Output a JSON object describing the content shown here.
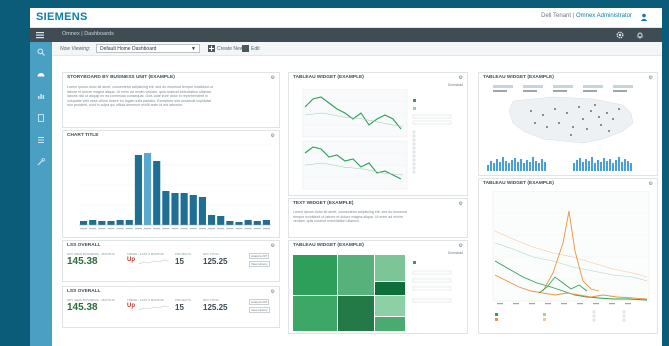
{
  "app": {
    "brand": "SIEMENS",
    "user_name": "Dell Tenant",
    "separator": "|",
    "user_role": "Omnex Administrator"
  },
  "breadcrumb": "Omnex | Dashboards",
  "viewbar": {
    "label": "Now Viewing:",
    "selected": "Default Home Dashboard",
    "create_new": "Create New",
    "edit": "Edit"
  },
  "storyboard": {
    "title": "STORYBOARD BY BUSINESS UNIT (EXAMPLE)",
    "lines": [
      "Lorem ipsum dolor sit amet, consectetur adipiscing elit, sed do eiusmod tempor incididunt ut",
      "labore et dolore magna aliqua. Ut enim ad minim veniam, quis nostrud exercitation ullamco",
      "laboris nisi ut aliquip ex ea commodo consequat. Duis aute irure dolor in reprehenderit in",
      "voluptate velit esse cillum dolore eu fugiat nulla pariatur. Excepteur sint occaecat cupidatat",
      "non proident, sunt in culpa qui officia deserunt mollit anim id est laborum."
    ]
  },
  "chart_title": {
    "title": "CHART TITLE"
  },
  "chart_data": {
    "type": "bar",
    "title": "CHART TITLE",
    "categories": [
      "1",
      "2",
      "3",
      "4",
      "5",
      "6",
      "7",
      "8",
      "9",
      "10",
      "11",
      "12",
      "13",
      "14",
      "15",
      "16",
      "17",
      "18",
      "19",
      "20",
      "21"
    ],
    "values": [
      4,
      5,
      4,
      4,
      5,
      5,
      70,
      72,
      64,
      34,
      32,
      32,
      30,
      28,
      10,
      9,
      4,
      3,
      5,
      4,
      5
    ],
    "highlight_index": 7,
    "ylim": [
      0,
      80
    ],
    "colors": {
      "bar": "#1f6e94",
      "highlight": "#5aa9cf"
    }
  },
  "lss1": {
    "title": "LSS OVERALL",
    "label1": "NPV (NEW BUSINESS) - MONTHS",
    "value1": "145.38",
    "label2": "TREND - LAST 6 MONTHS",
    "trend": "Up",
    "label3": "PROJECTS",
    "value3": "15",
    "label4": "NPV TOTAL",
    "value4": "125.25",
    "btn1": "Analyze KPI",
    "btn2": "View History"
  },
  "lss2": {
    "title": "LSS OVERALL",
    "label1": "NPV (NEW BUSINESS) - MONTHS",
    "value1": "145.38",
    "label2": "TREND - LAST 6 MONTHS",
    "trend": "Up",
    "label3": "PROJECTS",
    "value3": "15",
    "label4": "NPV TOTAL",
    "value4": "125.25",
    "btn1": "Analyze KPI",
    "btn2": "View History"
  },
  "tableau1": {
    "title": "TABLEAU WIDGET (EXAMPLE)",
    "download": "Download"
  },
  "text_widget": {
    "title": "TEXT WIDGET (EXAMPLE)",
    "lines": [
      "Lorem ipsum dolor sit amet, consectetur adipiscing elit, sed do eiusmod",
      "tempor incididunt ut labore et dolore magna aliqua. Ut enim ad minim",
      "veniam, quis nostrud exercitation ullamco."
    ]
  },
  "tableau2": {
    "title": "TABLEAU WIDGET (EXAMPLE)",
    "download": "Download"
  },
  "tableau3": {
    "title": "TABLEAU WIDGET (EXAMPLE)"
  },
  "tableau4": {
    "title": "TABLEAU WIDGET (EXAMPLE)"
  },
  "colors": {
    "accent": "#0f7fa6",
    "sidebar": "#4aa0c2",
    "green": "#2e9e5b",
    "orange": "#e8963a",
    "teal": "#1f6e94"
  }
}
